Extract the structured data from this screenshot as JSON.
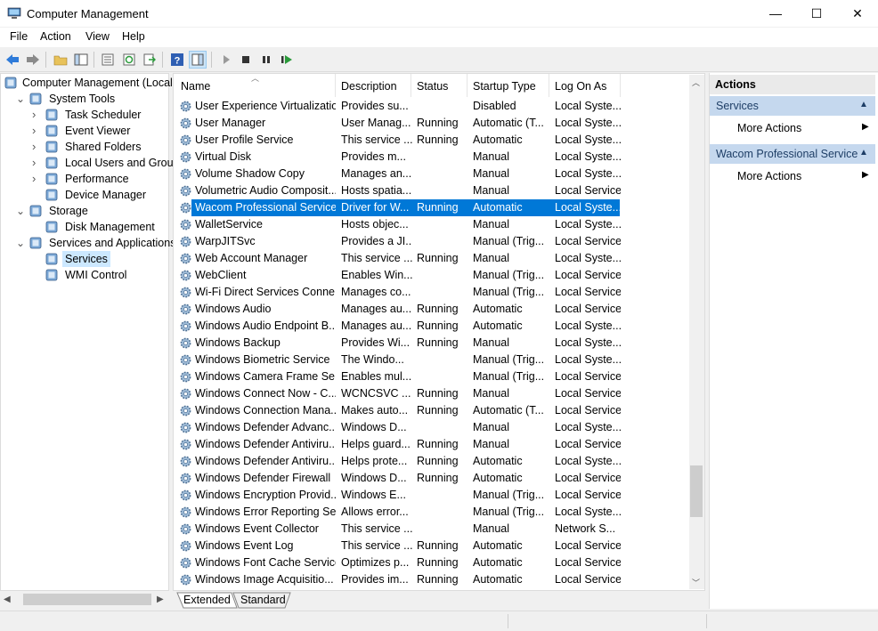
{
  "window": {
    "title": "Computer Management",
    "minimize": "—",
    "maximize": "☐",
    "close": "✕"
  },
  "menu": [
    "File",
    "Action",
    "View",
    "Help"
  ],
  "tree": [
    {
      "label": "Computer Management (Local)",
      "level": 0,
      "arrow": "",
      "icon": "computer-icon"
    },
    {
      "label": "System Tools",
      "level": 1,
      "arrow": "expanded",
      "icon": "tools-icon"
    },
    {
      "label": "Task Scheduler",
      "level": 2,
      "arrow": "collapsed",
      "icon": "clock-icon"
    },
    {
      "label": "Event Viewer",
      "level": 2,
      "arrow": "collapsed",
      "icon": "event-viewer-icon"
    },
    {
      "label": "Shared Folders",
      "level": 2,
      "arrow": "collapsed",
      "icon": "shared-folder-icon"
    },
    {
      "label": "Local Users and Groups",
      "level": 2,
      "arrow": "collapsed",
      "icon": "users-icon"
    },
    {
      "label": "Performance",
      "level": 2,
      "arrow": "collapsed",
      "icon": "performance-icon"
    },
    {
      "label": "Device Manager",
      "level": 2,
      "arrow": "",
      "icon": "device-manager-icon"
    },
    {
      "label": "Storage",
      "level": 1,
      "arrow": "expanded",
      "icon": "storage-icon"
    },
    {
      "label": "Disk Management",
      "level": 2,
      "arrow": "",
      "icon": "disk-icon"
    },
    {
      "label": "Services and Applications",
      "level": 1,
      "arrow": "expanded",
      "icon": "services-apps-icon"
    },
    {
      "label": "Services",
      "level": 2,
      "arrow": "",
      "icon": "services-icon",
      "selected": true
    },
    {
      "label": "WMI Control",
      "level": 2,
      "arrow": "",
      "icon": "wmi-icon"
    }
  ],
  "columns": {
    "name": "Name",
    "description": "Description",
    "status": "Status",
    "startup": "Startup Type",
    "logon": "Log On As"
  },
  "services": [
    {
      "name": "User Experience Virtualizatio...",
      "desc": "Provides su...",
      "status": "",
      "startup": "Disabled",
      "logon": "Local Syste..."
    },
    {
      "name": "User Manager",
      "desc": "User Manag...",
      "status": "Running",
      "startup": "Automatic (T...",
      "logon": "Local Syste..."
    },
    {
      "name": "User Profile Service",
      "desc": "This service ...",
      "status": "Running",
      "startup": "Automatic",
      "logon": "Local Syste..."
    },
    {
      "name": "Virtual Disk",
      "desc": "Provides m...",
      "status": "",
      "startup": "Manual",
      "logon": "Local Syste..."
    },
    {
      "name": "Volume Shadow Copy",
      "desc": "Manages an...",
      "status": "",
      "startup": "Manual",
      "logon": "Local Syste..."
    },
    {
      "name": "Volumetric Audio Composit...",
      "desc": "Hosts spatia...",
      "status": "",
      "startup": "Manual",
      "logon": "Local Service"
    },
    {
      "name": "Wacom Professional Service",
      "desc": "Driver for W...",
      "status": "Running",
      "startup": "Automatic",
      "logon": "Local Syste...",
      "selected": true
    },
    {
      "name": "WalletService",
      "desc": "Hosts objec...",
      "status": "",
      "startup": "Manual",
      "logon": "Local Syste..."
    },
    {
      "name": "WarpJITSvc",
      "desc": "Provides a JI...",
      "status": "",
      "startup": "Manual (Trig...",
      "logon": "Local Service"
    },
    {
      "name": "Web Account Manager",
      "desc": "This service ...",
      "status": "Running",
      "startup": "Manual",
      "logon": "Local Syste..."
    },
    {
      "name": "WebClient",
      "desc": "Enables Win...",
      "status": "",
      "startup": "Manual (Trig...",
      "logon": "Local Service"
    },
    {
      "name": "Wi-Fi Direct Services Conne...",
      "desc": "Manages co...",
      "status": "",
      "startup": "Manual (Trig...",
      "logon": "Local Service"
    },
    {
      "name": "Windows Audio",
      "desc": "Manages au...",
      "status": "Running",
      "startup": "Automatic",
      "logon": "Local Service"
    },
    {
      "name": "Windows Audio Endpoint B...",
      "desc": "Manages au...",
      "status": "Running",
      "startup": "Automatic",
      "logon": "Local Syste..."
    },
    {
      "name": "Windows Backup",
      "desc": "Provides Wi...",
      "status": "Running",
      "startup": "Manual",
      "logon": "Local Syste..."
    },
    {
      "name": "Windows Biometric Service",
      "desc": "The Windo...",
      "status": "",
      "startup": "Manual (Trig...",
      "logon": "Local Syste..."
    },
    {
      "name": "Windows Camera Frame Se...",
      "desc": "Enables mul...",
      "status": "",
      "startup": "Manual (Trig...",
      "logon": "Local Service"
    },
    {
      "name": "Windows Connect Now - C...",
      "desc": "WCNCSVC ...",
      "status": "Running",
      "startup": "Manual",
      "logon": "Local Service"
    },
    {
      "name": "Windows Connection Mana...",
      "desc": "Makes auto...",
      "status": "Running",
      "startup": "Automatic (T...",
      "logon": "Local Service"
    },
    {
      "name": "Windows Defender Advanc...",
      "desc": "Windows D...",
      "status": "",
      "startup": "Manual",
      "logon": "Local Syste..."
    },
    {
      "name": "Windows Defender Antiviru...",
      "desc": "Helps guard...",
      "status": "Running",
      "startup": "Manual",
      "logon": "Local Service"
    },
    {
      "name": "Windows Defender Antiviru...",
      "desc": "Helps prote...",
      "status": "Running",
      "startup": "Automatic",
      "logon": "Local Syste..."
    },
    {
      "name": "Windows Defender Firewall",
      "desc": "Windows D...",
      "status": "Running",
      "startup": "Automatic",
      "logon": "Local Service"
    },
    {
      "name": "Windows Encryption Provid...",
      "desc": "Windows E...",
      "status": "",
      "startup": "Manual (Trig...",
      "logon": "Local Service"
    },
    {
      "name": "Windows Error Reporting Se...",
      "desc": "Allows error...",
      "status": "",
      "startup": "Manual (Trig...",
      "logon": "Local Syste..."
    },
    {
      "name": "Windows Event Collector",
      "desc": "This service ...",
      "status": "",
      "startup": "Manual",
      "logon": "Network S..."
    },
    {
      "name": "Windows Event Log",
      "desc": "This service ...",
      "status": "Running",
      "startup": "Automatic",
      "logon": "Local Service"
    },
    {
      "name": "Windows Font Cache Service",
      "desc": "Optimizes p...",
      "status": "Running",
      "startup": "Automatic",
      "logon": "Local Service"
    },
    {
      "name": "Windows Image Acquisitio...",
      "desc": "Provides im...",
      "status": "Running",
      "startup": "Automatic",
      "logon": "Local Service"
    }
  ],
  "tabs": {
    "extended": "Extended",
    "standard": "Standard"
  },
  "actions": {
    "title": "Actions",
    "sections": [
      {
        "header": "Services",
        "items": [
          "More Actions"
        ]
      },
      {
        "header": "Wacom Professional Service",
        "items": [
          "More Actions"
        ]
      }
    ]
  },
  "colors": {
    "selection": "#0078d7",
    "action_header": "#c5d8ee"
  }
}
